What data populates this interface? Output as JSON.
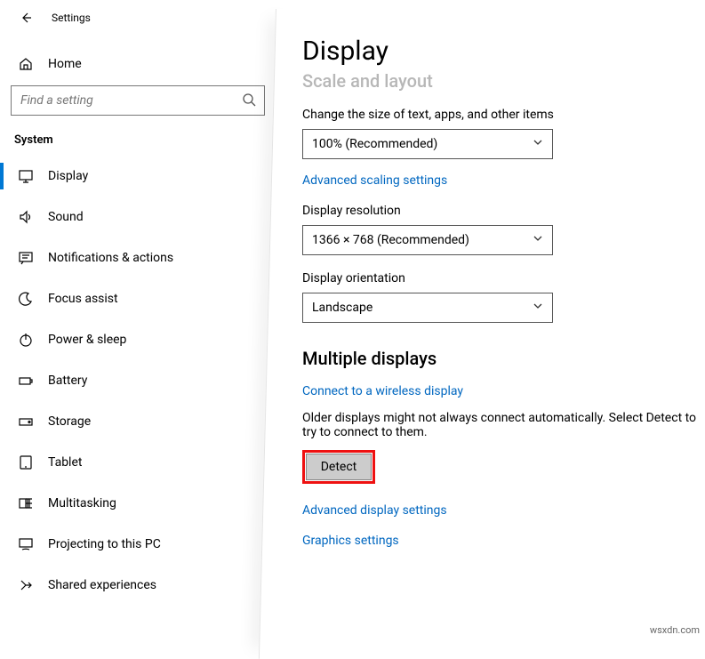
{
  "window": {
    "title": "Settings"
  },
  "sidebar": {
    "home": "Home",
    "search_placeholder": "Find a setting",
    "section": "System",
    "items": [
      {
        "label": "Display",
        "selected": true
      },
      {
        "label": "Sound"
      },
      {
        "label": "Notifications & actions"
      },
      {
        "label": "Focus assist"
      },
      {
        "label": "Power & sleep"
      },
      {
        "label": "Battery"
      },
      {
        "label": "Storage"
      },
      {
        "label": "Tablet"
      },
      {
        "label": "Multitasking"
      },
      {
        "label": "Projecting to this PC"
      },
      {
        "label": "Shared experiences"
      }
    ]
  },
  "main": {
    "title": "Display",
    "scale_heading_faded": "Scale and layout",
    "scale_label": "Change the size of text, apps, and other items",
    "scale_value": "100% (Recommended)",
    "advanced_scaling_link": "Advanced scaling settings",
    "resolution_label": "Display resolution",
    "resolution_value": "1366 × 768 (Recommended)",
    "orientation_label": "Display orientation",
    "orientation_value": "Landscape",
    "multiple_heading": "Multiple displays",
    "wireless_link": "Connect to a wireless display",
    "detect_text": "Older displays might not always connect automatically. Select Detect to try to connect to them.",
    "detect_button": "Detect",
    "advanced_display_link": "Advanced display settings",
    "graphics_link": "Graphics settings"
  },
  "footer": "wsxdn.com"
}
